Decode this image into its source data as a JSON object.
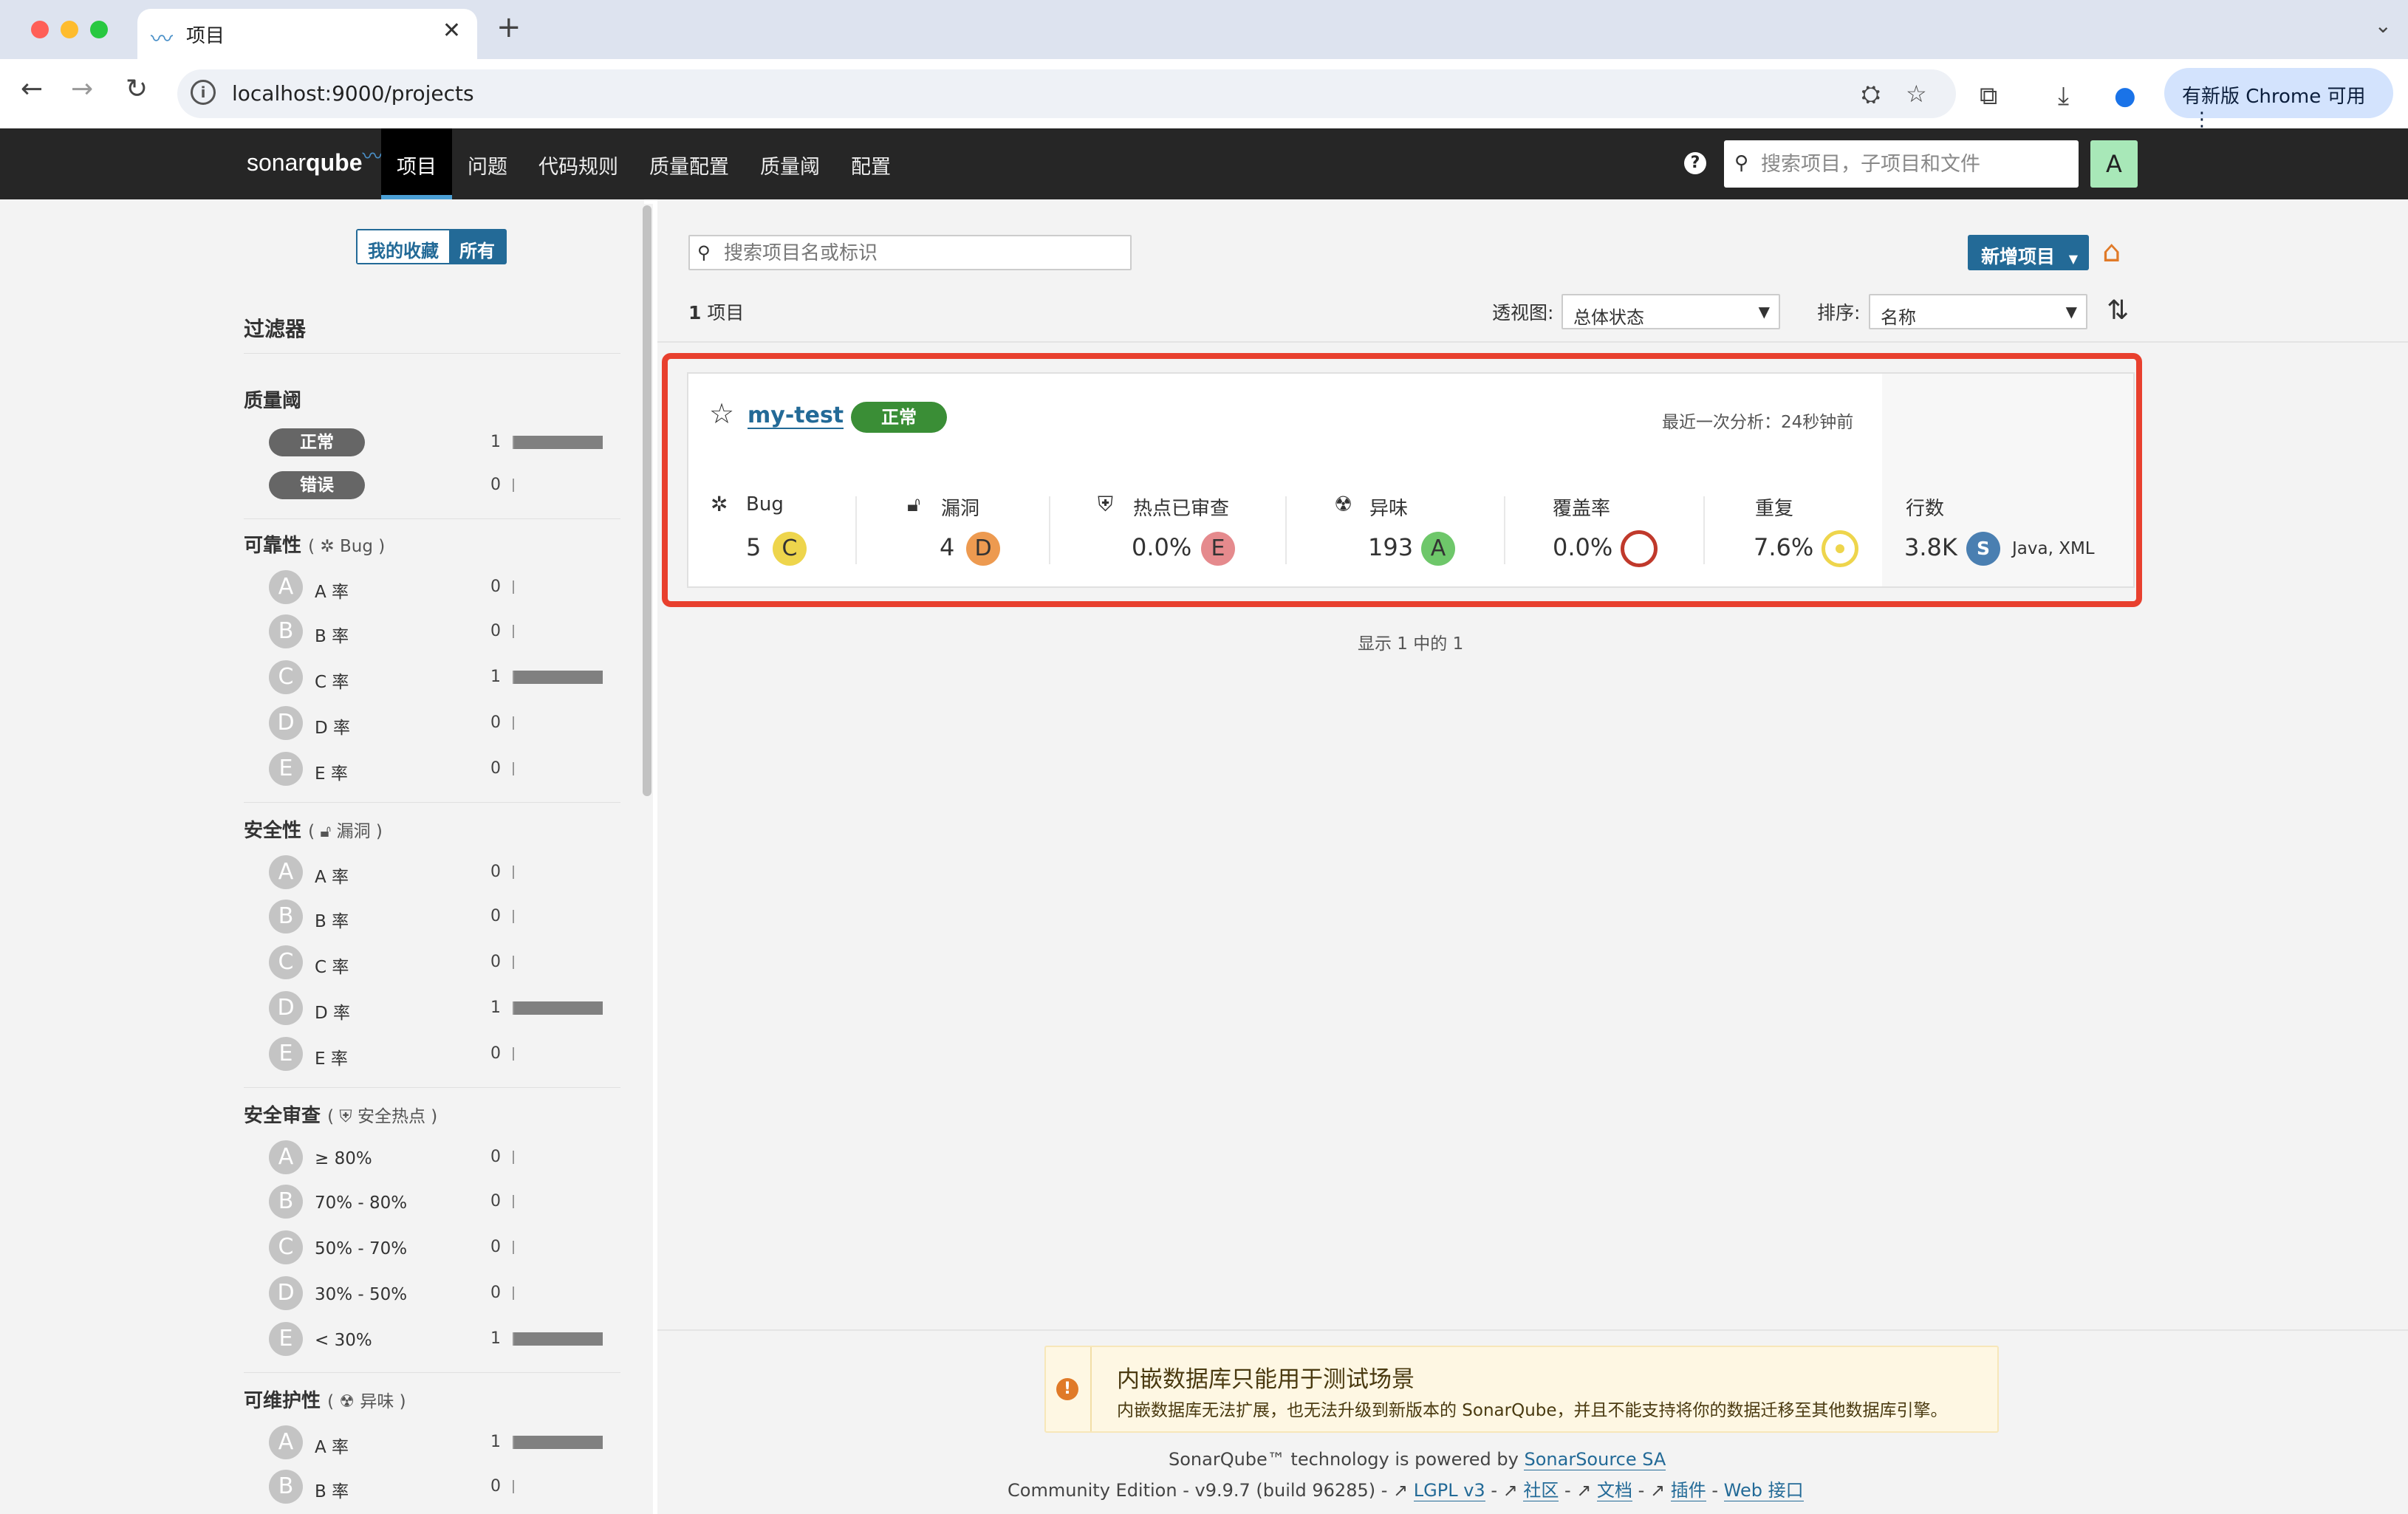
{
  "browser": {
    "tab_title": "项目",
    "url": "localhost:9000/projects",
    "update_label": "有新版 Chrome 可用",
    "colors": {
      "close": "#ff5f57",
      "minimize": "#febc2e",
      "zoom": "#28c840"
    }
  },
  "nav": {
    "logo_regular": "sonar",
    "logo_bold": "qube",
    "items": [
      "项目",
      "问题",
      "代码规则",
      "质量配置",
      "质量阈",
      "配置"
    ],
    "active_index": 0,
    "help_label": "?",
    "search_placeholder": "搜索项目，子项目和文件",
    "avatar_letter": "A"
  },
  "sidebar": {
    "toggle": {
      "favorites": "我的收藏",
      "all": "所有"
    },
    "filters_title": "过滤器",
    "quality_gate": {
      "title": "质量阈",
      "items": [
        {
          "label": "正常",
          "count": "1",
          "value": 1
        },
        {
          "label": "错误",
          "count": "0",
          "value": 0
        }
      ]
    },
    "reliability": {
      "title": "可靠性",
      "sub": "Bug",
      "items": [
        {
          "grade": "A",
          "label": "A 率",
          "count": "0",
          "value": 0
        },
        {
          "grade": "B",
          "label": "B 率",
          "count": "0",
          "value": 0
        },
        {
          "grade": "C",
          "label": "C 率",
          "count": "1",
          "value": 1
        },
        {
          "grade": "D",
          "label": "D 率",
          "count": "0",
          "value": 0
        },
        {
          "grade": "E",
          "label": "E 率",
          "count": "0",
          "value": 0
        }
      ]
    },
    "security": {
      "title": "安全性",
      "sub": "漏洞",
      "items": [
        {
          "grade": "A",
          "label": "A 率",
          "count": "0",
          "value": 0
        },
        {
          "grade": "B",
          "label": "B 率",
          "count": "0",
          "value": 0
        },
        {
          "grade": "C",
          "label": "C 率",
          "count": "0",
          "value": 0
        },
        {
          "grade": "D",
          "label": "D 率",
          "count": "1",
          "value": 1
        },
        {
          "grade": "E",
          "label": "E 率",
          "count": "0",
          "value": 0
        }
      ]
    },
    "security_review": {
      "title": "安全审查",
      "sub": "安全热点",
      "items": [
        {
          "grade": "A",
          "label": "≥ 80%",
          "count": "0",
          "value": 0
        },
        {
          "grade": "B",
          "label": "70% - 80%",
          "count": "0",
          "value": 0
        },
        {
          "grade": "C",
          "label": "50% - 70%",
          "count": "0",
          "value": 0
        },
        {
          "grade": "D",
          "label": "30% - 50%",
          "count": "0",
          "value": 0
        },
        {
          "grade": "E",
          "label": "< 30%",
          "count": "1",
          "value": 1
        }
      ]
    },
    "maintainability": {
      "title": "可维护性",
      "sub": "异味",
      "items": [
        {
          "grade": "A",
          "label": "A 率",
          "count": "1",
          "value": 1
        },
        {
          "grade": "B",
          "label": "B 率",
          "count": "0",
          "value": 0
        }
      ]
    }
  },
  "main": {
    "search_placeholder": "搜索项目名或标识",
    "new_project_label": "新增项目",
    "count_num": "1",
    "count_label": "项目",
    "perspective_label": "透视图:",
    "perspective_value": "总体状态",
    "sort_label": "排序:",
    "sort_value": "名称",
    "showing": "显示 1 中的 1"
  },
  "project": {
    "name": "my-test",
    "status": "正常",
    "last_analysis": "最近一次分析：24秒钟前",
    "metrics": {
      "bug": {
        "label": "Bug",
        "value": "5",
        "grade": "C",
        "color": "#eed54c"
      },
      "vuln": {
        "label": "漏洞",
        "value": "4",
        "grade": "D",
        "color": "#ed7d20"
      },
      "hotspots": {
        "label": "热点已审查",
        "value": "0.0%",
        "grade": "E",
        "color": "#e58a8d"
      },
      "smells": {
        "label": "异味",
        "value": "193",
        "grade": "A",
        "color": "#6ec76a"
      },
      "coverage": {
        "label": "覆盖率",
        "value": "0.0%"
      },
      "duplication": {
        "label": "重复",
        "value": "7.6%"
      },
      "lines": {
        "label": "行数",
        "value": "3.8K",
        "size": "S",
        "languages": "Java, XML"
      }
    }
  },
  "footer": {
    "warning_title": "内嵌数据库只能用于测试场景",
    "warning_desc": "内嵌数据库无法扩展，也无法升级到新版本的 SonarQube，并且不能支持将你的数据迁移至其他数据库引擎。",
    "powered_prefix": "SonarQube™ technology is powered by ",
    "powered_link": "SonarSource SA",
    "edition": "Community Edition - v9.9.7 (build 96285) - ",
    "links": [
      "LGPL v3",
      "社区",
      "文档",
      "插件",
      "Web 接口"
    ]
  }
}
